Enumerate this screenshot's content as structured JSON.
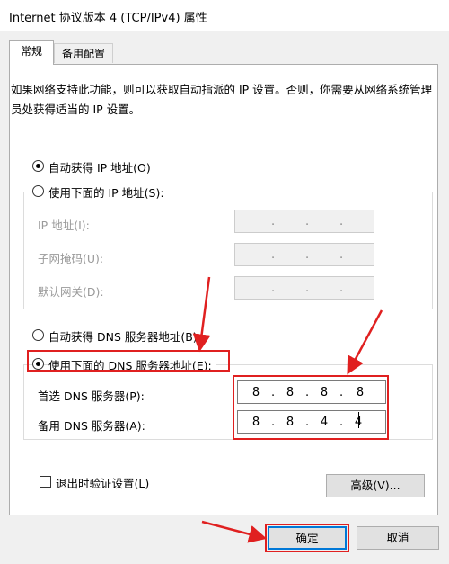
{
  "window": {
    "title": "Internet 协议版本 4 (TCP/IPv4) 属性"
  },
  "tabs": [
    {
      "label": "常规"
    },
    {
      "label": "备用配置"
    }
  ],
  "description": "如果网络支持此功能，则可以获取自动指派的 IP 设置。否则，你需要从网络系统管理员处获得适当的 IP 设置。",
  "ip": {
    "auto_label": "自动获得 IP 地址(O)",
    "manual_label": "使用下面的 IP 地址(S):",
    "address_label": "IP 地址(I):",
    "mask_label": "子网掩码(U):",
    "gateway_label": "默认网关(D):"
  },
  "dns": {
    "auto_label": "自动获得 DNS 服务器地址(B)",
    "manual_label": "使用下面的 DNS 服务器地址(E):",
    "preferred_label": "首选 DNS 服务器(P):",
    "alternate_label": "备用 DNS 服务器(A):",
    "preferred": [
      "8",
      "8",
      "8",
      "8"
    ],
    "alternate": [
      "8",
      "8",
      "4",
      "4"
    ]
  },
  "validate_label": "退出时验证设置(L)",
  "advanced_label": "高级(V)...",
  "ok_label": "确定",
  "cancel_label": "取消",
  "colors": {
    "accent": "#0078d7",
    "highlight": "#e02020"
  }
}
